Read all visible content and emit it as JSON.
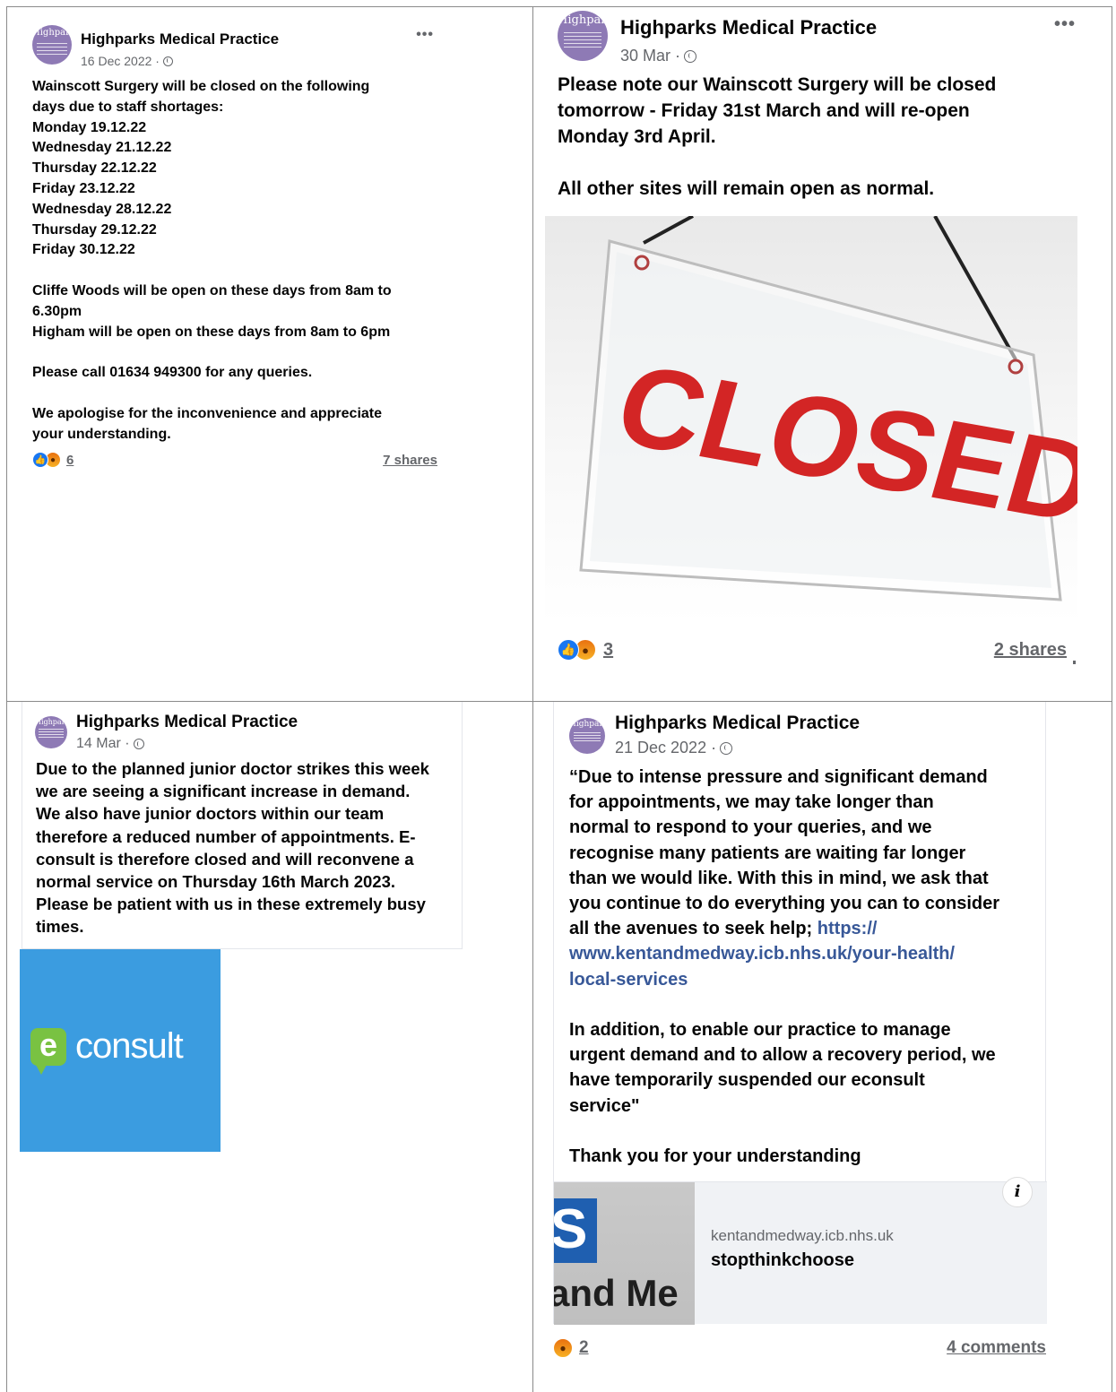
{
  "page_name": "Highparks Medical Practice",
  "avatar_text": "Highparks",
  "more_label": "•••",
  "posts": {
    "tl": {
      "date": "16 Dec 2022 ·",
      "body": "Wainscott Surgery will be closed on the following\ndays due to staff shortages:\nMonday 19.12.22\nWednesday 21.12.22\nThursday 22.12.22\nFriday 23.12.22\nWednesday 28.12.22\nThursday 29.12.22\nFriday 30.12.22\n\nCliffe Woods will be open on these days from 8am to\n6.30pm\nHigham will be open on these days from 8am to 6pm\n\nPlease call 01634 949300 for any queries.\n\nWe apologise for the inconvenience and appreciate\nyour understanding.",
      "reaction_count": "6",
      "shares": "7 shares"
    },
    "tr": {
      "date": "30 Mar ·",
      "body": "Please note our Wainscott Surgery will be closed\ntomorrow - Friday 31st March and will re-open\nMonday 3rd April.\n\nAll other sites will remain open as normal.",
      "image_text": "CLOSED",
      "reaction_count": "3",
      "shares": "2 shares"
    },
    "bl": {
      "date": "14 Mar ·",
      "body": "Due to the planned junior doctor strikes this week\nwe are seeing a significant increase in demand.\nWe also have junior doctors within our team\ntherefore a reduced number of appointments. E-\nconsult is therefore closed and will reconvene a\nnormal service on Thursday 16th March 2023.\nPlease be patient with us in these extremely busy\ntimes.",
      "image_logo_letter": "e",
      "image_logo_word": "consult"
    },
    "br": {
      "date": "21 Dec 2022 ·",
      "body_start": "“Due to intense pressure and significant demand\nfor appointments, we may take longer than\nnormal to respond to your queries, and we\nrecognise many patients are waiting far longer\nthan we would like. With this in mind, we ask that\nyou continue to do everything you can to consider\nall the avenues to seek help; ",
      "link": "https://\nwww.kentandmedway.icb.nhs.uk/your-health/\nlocal-services",
      "body_end": "\n\nIn addition, to enable our practice to manage\nurgent demand and to allow a recovery period, we\nhave temporarily suspended our econsult\nservice\"\n\nThank you for your understanding",
      "preview_domain": "kentandmedway.icb.nhs.uk",
      "preview_title": "stopthinkchoose",
      "preview_thumb_letter": "S",
      "preview_thumb_word": "and Me",
      "info_label": "i",
      "reaction_count": "2",
      "comments": "4 comments"
    }
  },
  "icons": {
    "like": "like-icon",
    "angry": "angry-icon",
    "globe": "globe-icon",
    "more": "more-options-icon",
    "info": "info-icon"
  },
  "colors": {
    "like_blue": "#1877f2",
    "angry_orange": "#e9710f",
    "link_blue": "#385898",
    "closed_red": "#d32525",
    "econsult_blue": "#3b9ce0",
    "econsult_green": "#79c242",
    "avatar_purple": "#8e7ab5"
  }
}
